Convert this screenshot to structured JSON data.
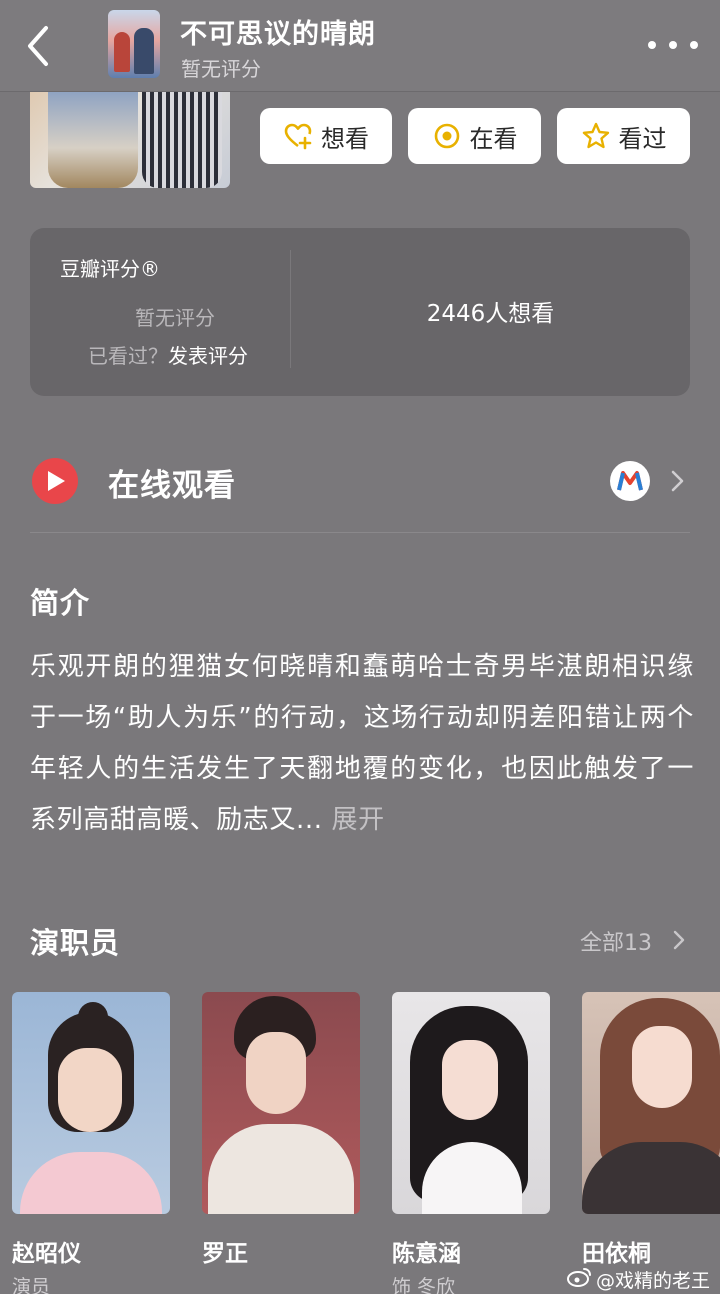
{
  "header": {
    "title": "不可思议的晴朗",
    "subtitle": "暂无评分"
  },
  "actions": {
    "want": "想看",
    "watching": "在看",
    "watched": "看过"
  },
  "rating": {
    "brand": "豆瓣评分®",
    "status": "暂无评分",
    "seen_prompt": "已看过？",
    "post_link": "发表评分",
    "want_count": "2446人想看"
  },
  "watch": {
    "label": "在线观看"
  },
  "intro": {
    "title": "简介",
    "text": "乐观开朗的狸猫女何晓晴和蠢萌哈士奇男毕湛朗相识缘于一场“助人为乐”的行动，这场行动却阴差阳错让两个年轻人的生活发生了天翻地覆的变化，也因此触发了一系列高甜高暖、励志又...",
    "expand": "展开"
  },
  "cast": {
    "title": "演职员",
    "all_label": "全部13",
    "members": [
      {
        "name": "赵昭仪",
        "role": "演员"
      },
      {
        "name": "罗正",
        "role": ""
      },
      {
        "name": "陈意涵",
        "role": "饰 冬欣"
      },
      {
        "name": "田依桐",
        "role": ""
      }
    ]
  },
  "watermark": "@戏精的老王",
  "colors": {
    "background": "#7a787b",
    "card": "#686669",
    "play_red": "#e9464a",
    "icon_gold": "#e8b100"
  }
}
